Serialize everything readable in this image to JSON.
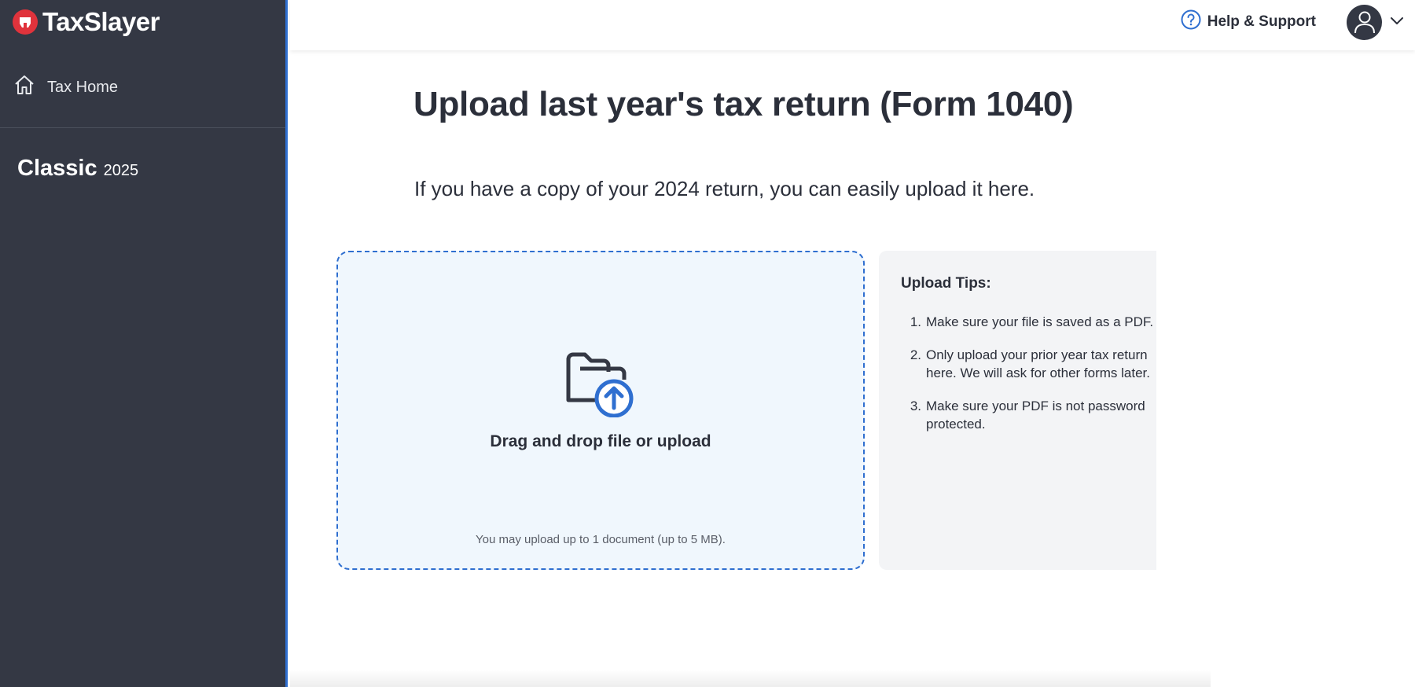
{
  "brand": {
    "name": "TaxSlayer",
    "accent": "#e0333c"
  },
  "sidebar": {
    "home_label": "Tax Home",
    "product_name": "Classic",
    "product_year": "2025"
  },
  "header": {
    "help_label": "Help & Support"
  },
  "main": {
    "title": "Upload last year's tax return (Form 1040)",
    "subtitle": "If you have a copy of your 2024 return, you can easily upload it here.",
    "dropzone": {
      "label": "Drag and drop file or upload",
      "limit_note": "You may upload up to 1 document (up to 5 MB)."
    },
    "tips": {
      "title": "Upload Tips:",
      "items": [
        {
          "num": "1.",
          "text": "Make sure your file is saved as a PDF."
        },
        {
          "num": "2.",
          "text": "Only upload your prior year tax return here. We will ask for other forms later."
        },
        {
          "num": "3.",
          "text": "Make sure your PDF is not password protected."
        }
      ]
    }
  },
  "colors": {
    "sidebar_bg": "#343844",
    "primary_blue": "#2f6fd0",
    "dropzone_bg": "#f0f7fd",
    "tips_bg": "#f3f4f6"
  }
}
